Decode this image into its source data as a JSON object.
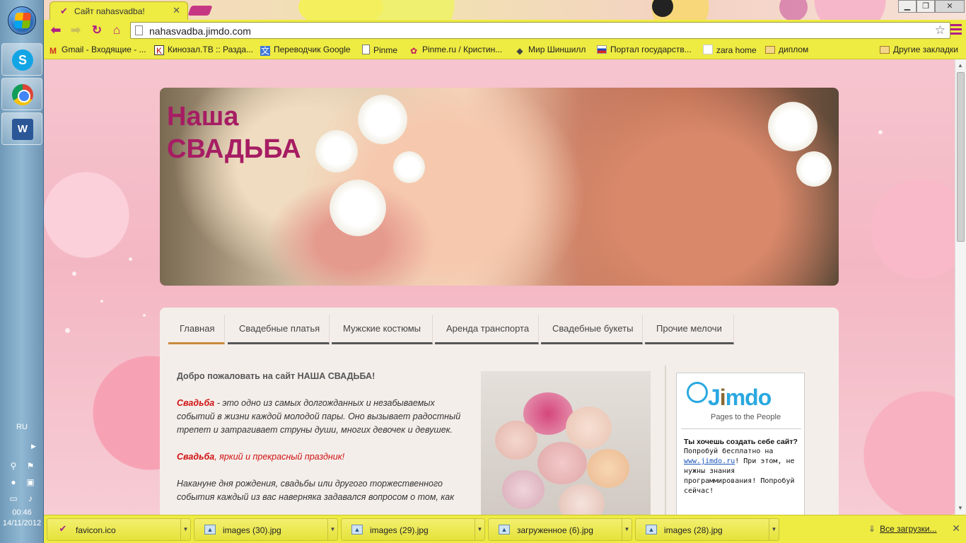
{
  "taskbar": {
    "apps": [
      {
        "name": "skype",
        "glyph": "S"
      },
      {
        "name": "chrome",
        "glyph": ""
      },
      {
        "name": "word",
        "glyph": "W"
      }
    ],
    "language": "RU",
    "time": "00:46",
    "date": "14/11/2012"
  },
  "browser": {
    "tab": {
      "title": "Сайт nahasvadba!",
      "favicon": "check-favicon-icon"
    },
    "url": "nahasvadba.jimdo.com",
    "bookmarks": [
      {
        "label": "Gmail - Входящие - ...",
        "icon": "gmail-icon"
      },
      {
        "label": "Кинозал.ТВ :: Разда...",
        "icon": "kinozal-icon"
      },
      {
        "label": "Переводчик Google",
        "icon": "translate-icon"
      },
      {
        "label": "Pinme",
        "icon": "page-icon"
      },
      {
        "label": "Pinme.ru / Кристин...",
        "icon": "pin-icon"
      },
      {
        "label": "Мир Шиншилл",
        "icon": "chinchilla-icon"
      },
      {
        "label": "Портал государств...",
        "icon": "russia-flag-icon"
      },
      {
        "label": "zara home",
        "icon": "blank-icon"
      },
      {
        "label": "диплом",
        "icon": "folder-icon"
      }
    ],
    "other_bookmarks": "Другие закладки",
    "accent": "#b01e86",
    "chrome_yellow": "#eeeb42"
  },
  "page": {
    "title_line1": "Наша",
    "title_line2": "СВАДЬБА",
    "title_color": "#a61d63",
    "nav": [
      {
        "label": "Главная",
        "active": true
      },
      {
        "label": "Свадебные платья",
        "active": false
      },
      {
        "label": "Мужские костюмы",
        "active": false
      },
      {
        "label": "Аренда транспорта",
        "active": false
      },
      {
        "label": "Свадебные букеты",
        "active": false
      },
      {
        "label": "Прочие мелочи",
        "active": false
      }
    ],
    "intro": {
      "welcome": "Добро пожаловать на сайт НАША СВАДЬБА!",
      "p1_lead": "Свадьба",
      "p1_rest": " - это одно из самых долгожданных и незабываемых событий в жизни каждой молодой пары. Оно вызывает радостный трепет и затрагивает струны души, многих девочек и девушек.",
      "p2_lead": "Свадьба",
      "p2_rest": ", яркий и прекрасный праздник!",
      "p3": "Накануне дня рождения, свадьбы или другого торжественного события каждый из вас наверняка задавался вопросом о том, как"
    },
    "ad": {
      "tagline": "Pages to the People",
      "question": "Ты хочешь создать себе сайт?",
      "line1": "Попробуй бесплатно на",
      "link": "www.jimdo.ru",
      "line2": "! При этом, не нужны знания программирования! Попробуй сейчас!"
    }
  },
  "downloads": {
    "items": [
      {
        "name": "favicon.ico",
        "icon": "check-favicon-icon"
      },
      {
        "name": "images (30).jpg",
        "icon": "image-file-icon"
      },
      {
        "name": "images (29).jpg",
        "icon": "image-file-icon"
      },
      {
        "name": "загруженное (6).jpg",
        "icon": "image-file-icon"
      },
      {
        "name": "images (28).jpg",
        "icon": "image-file-icon"
      }
    ],
    "all_label": "Все загрузки..."
  }
}
